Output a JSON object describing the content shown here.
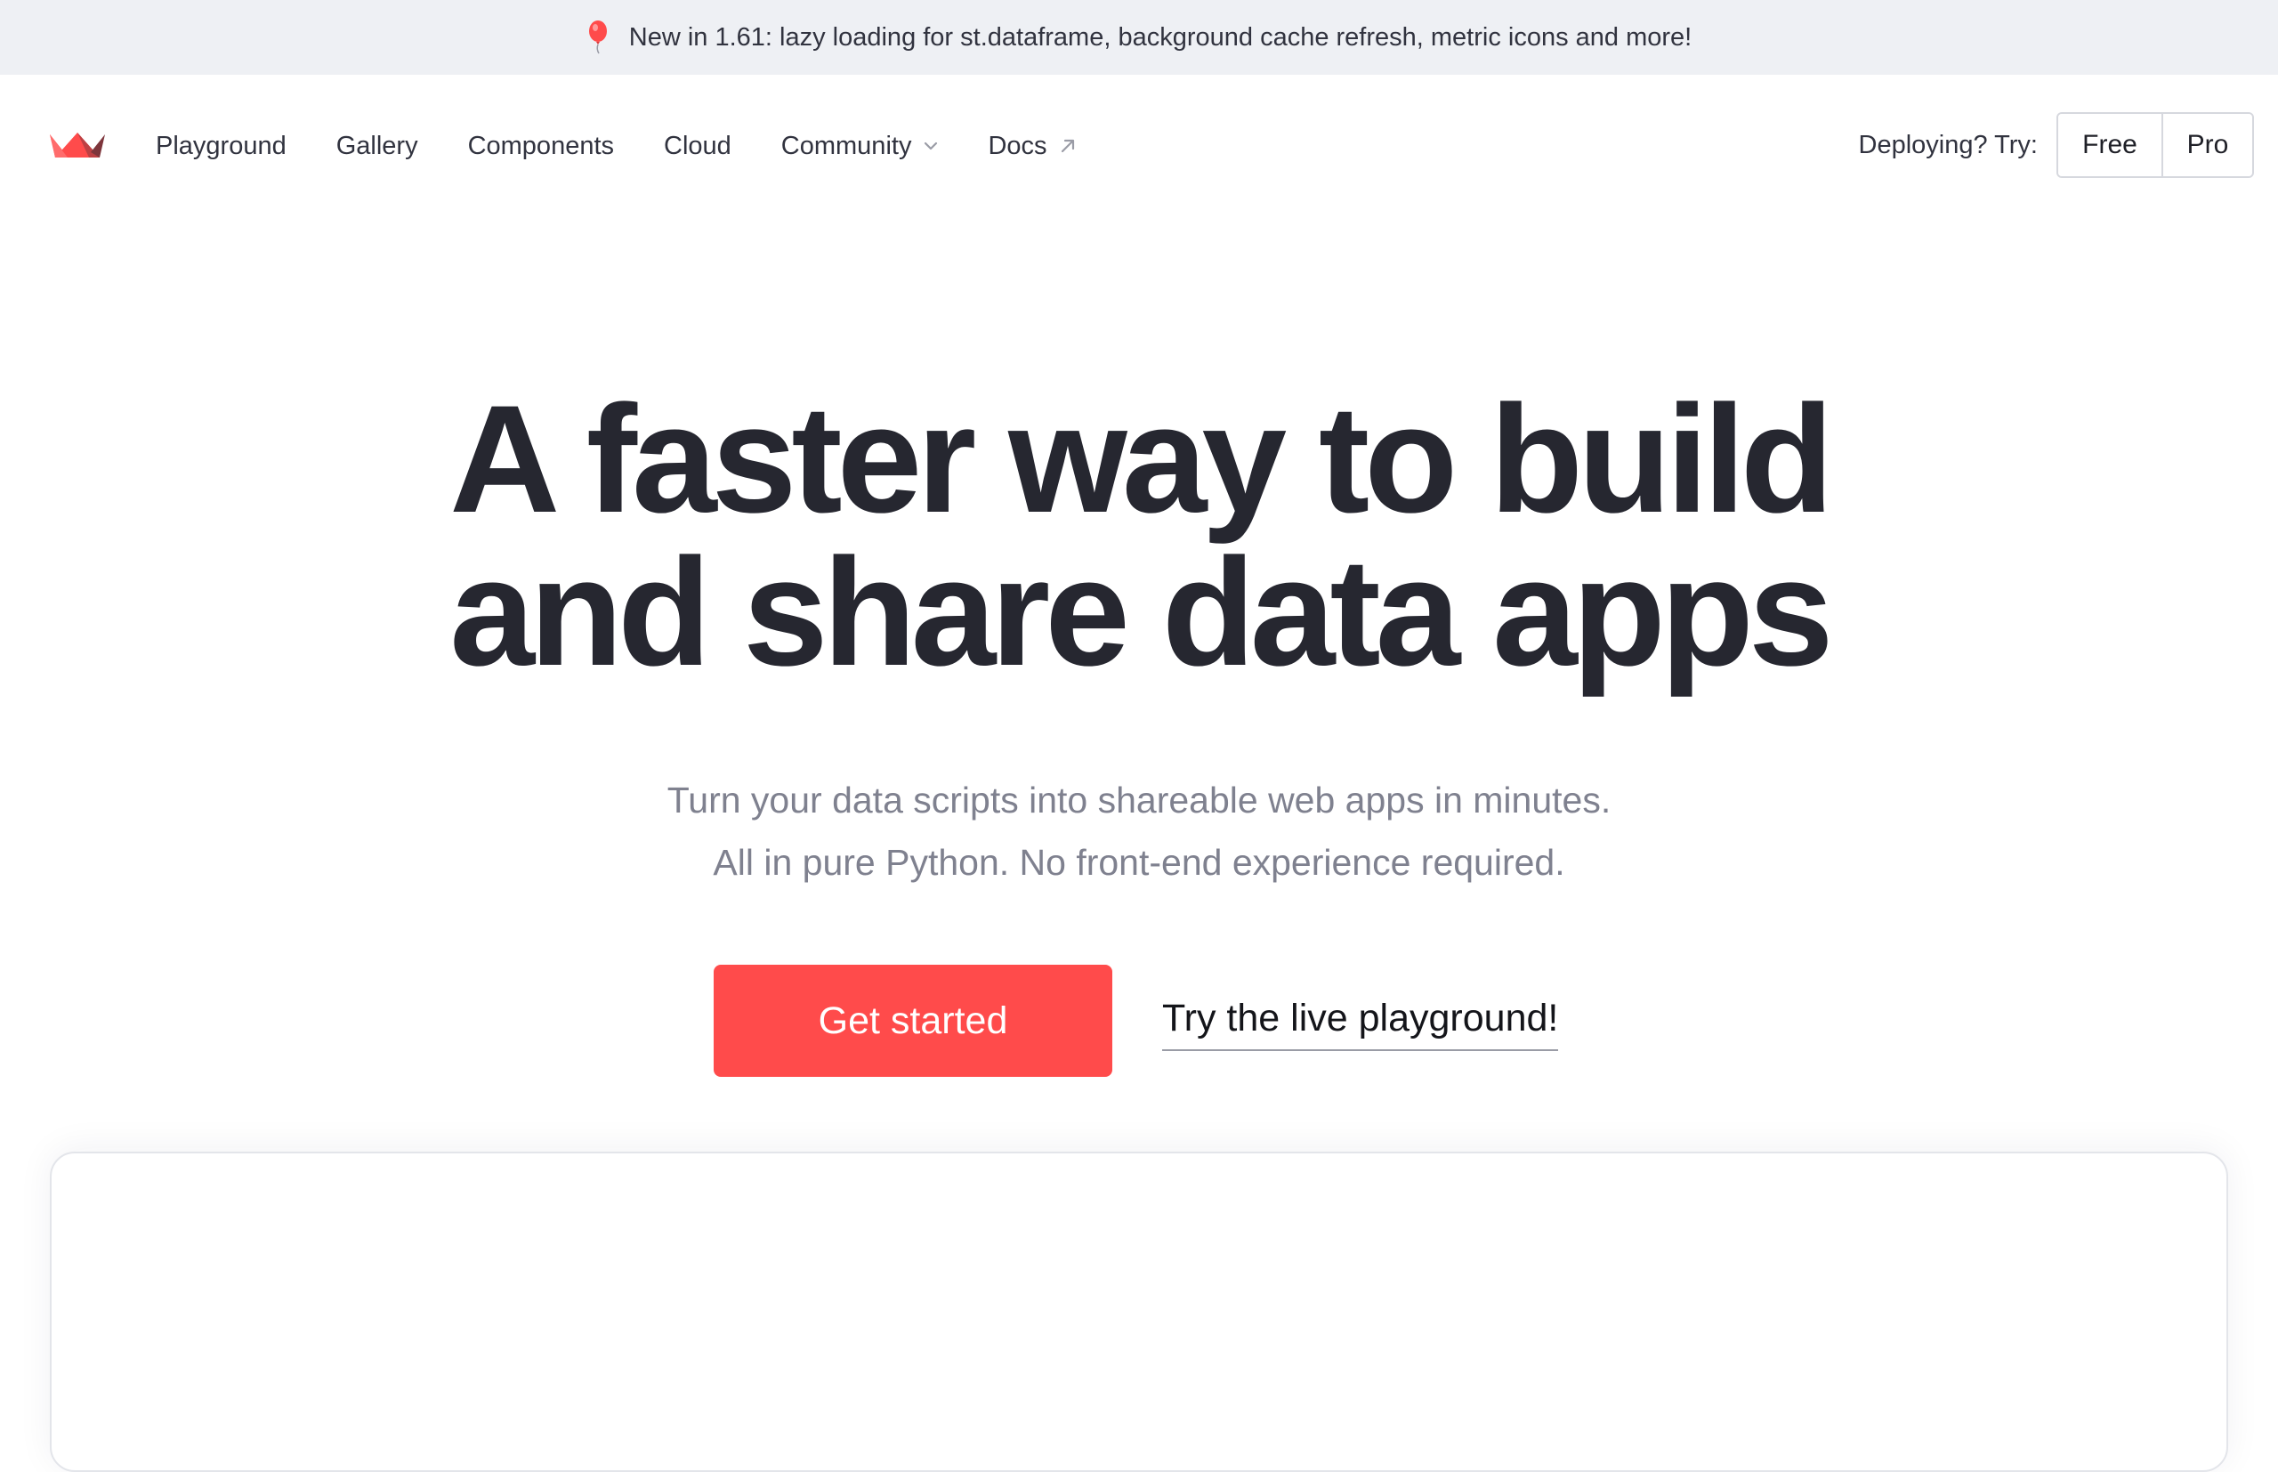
{
  "banner": {
    "icon": "balloon-icon",
    "text": "New in 1.61: lazy loading for st.dataframe, background cache refresh, metric icons and more!"
  },
  "nav": {
    "logo": "streamlit-crown-logo",
    "links": [
      {
        "label": "Playground"
      },
      {
        "label": "Gallery"
      },
      {
        "label": "Components"
      },
      {
        "label": "Cloud"
      },
      {
        "label": "Community",
        "icon": "chevron-down-icon"
      },
      {
        "label": "Docs",
        "icon": "external-arrow-icon"
      }
    ],
    "deploy_label": "Deploying? Try:",
    "deploy_options": {
      "free": "Free",
      "pro": "Pro"
    }
  },
  "hero": {
    "title_line1": "A faster way to build",
    "title_line2": "and share data apps",
    "subtitle_line1": "Turn your data scripts into shareable web apps in minutes.",
    "subtitle_line2": "All in pure Python. No front-end experience required.",
    "primary_cta": "Get started",
    "secondary_cta": "Try the live playground!"
  },
  "colors": {
    "accent": "#ff4b4b",
    "banner_bg": "#eef0f4",
    "text": "#262730",
    "muted": "#7f818f"
  }
}
